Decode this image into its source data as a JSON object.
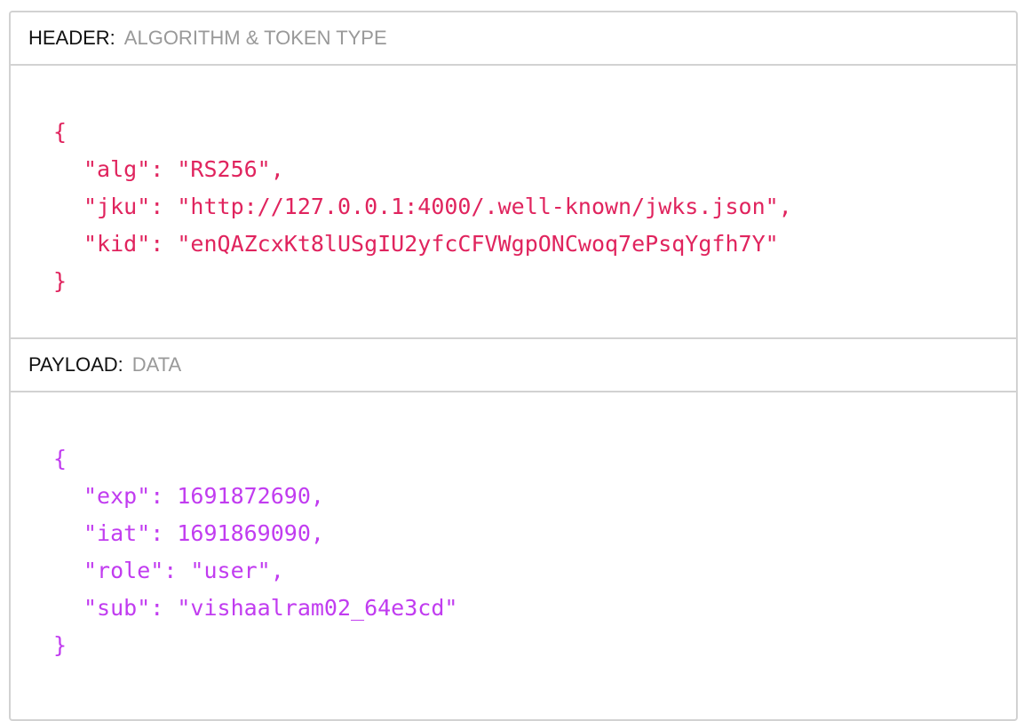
{
  "header_section": {
    "label": "HEADER:",
    "sublabel": "ALGORITHM & TOKEN TYPE",
    "open_brace": "{",
    "lines": [
      "\"alg\": \"RS256\",",
      "\"jku\": \"http://127.0.0.1:4000/.well-known/jwks.json\",",
      "\"kid\": \"enQAZcxKt8lUSgIU2yfcCFVWgpONCwoq7ePsqYgfh7Y\""
    ],
    "close_brace": "}",
    "text_color": "#e0245e"
  },
  "payload_section": {
    "label": "PAYLOAD:",
    "sublabel": "DATA",
    "open_brace": "{",
    "lines": [
      "\"exp\": 1691872690,",
      "\"iat\": 1691869090,",
      "\"role\": \"user\",",
      "\"sub\": \"vishaalram02_64e3cd\""
    ],
    "close_brace": "}",
    "text_color": "#c13cf0"
  }
}
